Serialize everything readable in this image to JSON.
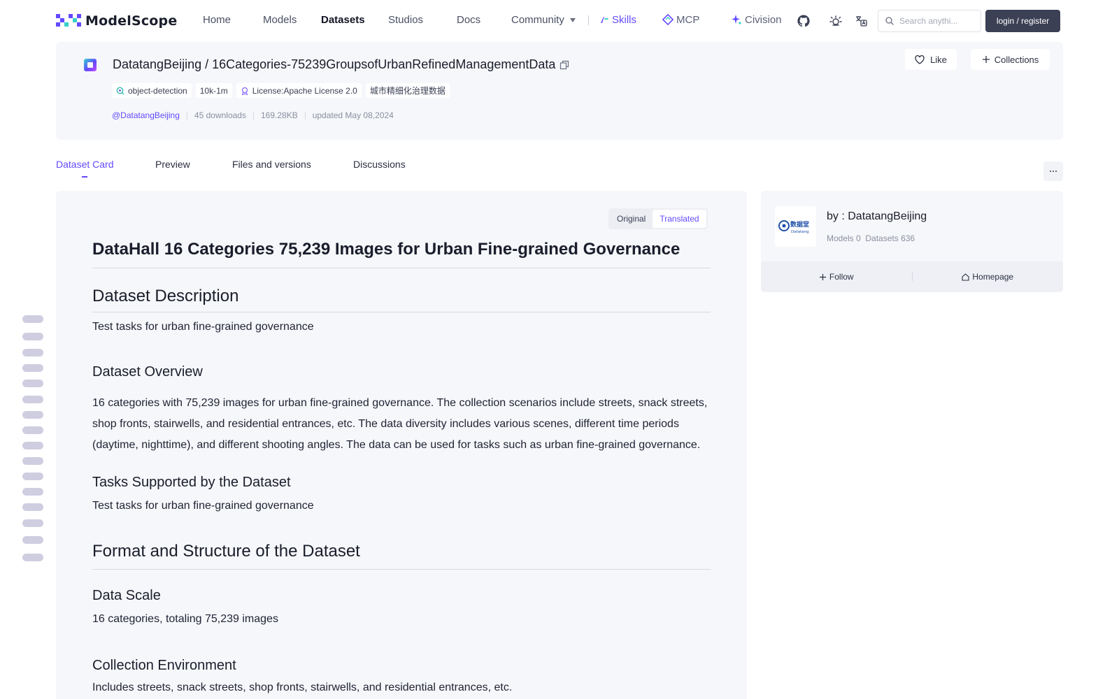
{
  "brand": {
    "name": "ModelScope",
    "accent": "#624aff"
  },
  "nav": {
    "home": "Home",
    "models": "Models",
    "datasets": "Datasets",
    "studios": "Studios",
    "docs": "Docs",
    "community": "Community",
    "skills": "Skills",
    "mcp": "MCP",
    "civision": "Civision",
    "search_placeholder": "Search anythi...",
    "login": "login / register"
  },
  "dataset": {
    "title": "DatatangBeijing / 16Categories-75239GroupsofUrbanRefinedManagementData",
    "tags": {
      "task": "object-detection",
      "size": "10k-1m",
      "license": "License:Apache License 2.0",
      "cn": "城市精细化治理数据"
    },
    "owner": "@DatatangBeijing",
    "downloads": "45 downloads",
    "filesize": "169.28KB",
    "updated": "updated May 08,2024",
    "like": "Like",
    "collections": "Collections"
  },
  "tabs": {
    "card": "Dataset Card",
    "preview": "Preview",
    "files": "Files and versions",
    "discussions": "Discussions"
  },
  "toggle": {
    "original": "Original",
    "translated": "Translated"
  },
  "doc": {
    "h1": "DataHall 16 Categories 75,239 Images for Urban Fine-grained Governance",
    "desc_h": "Dataset Description",
    "desc_p": "Test tasks for urban fine-grained governance",
    "overview_h": "Dataset Overview",
    "overview_p": "16 categories with 75,239 images for urban fine-grained governance. The collection scenarios include streets, snack streets, shop fronts, stairwells, and residential entrances, etc. The data diversity includes various scenes, different time periods (daytime, nighttime), and different shooting angles. The data can be used for tasks such as urban fine-grained governance.",
    "tasks_h": "Tasks Supported by the Dataset",
    "tasks_p": "Test tasks for urban fine-grained governance",
    "format_h": "Format and Structure of the Dataset",
    "scale_h": "Data Scale",
    "scale_p": "16 categories, totaling 75,239 images",
    "env_h": "Collection Environment",
    "env_p": "Includes streets, snack streets, shop fronts, stairwells, and residential entrances, etc."
  },
  "author": {
    "name": "by : DatatangBeijing",
    "logo_text": "数据堂",
    "logo_sub": "Datatang",
    "models": "Models 0",
    "datasets": "Datasets 636",
    "follow": "Follow",
    "homepage": "Homepage"
  }
}
